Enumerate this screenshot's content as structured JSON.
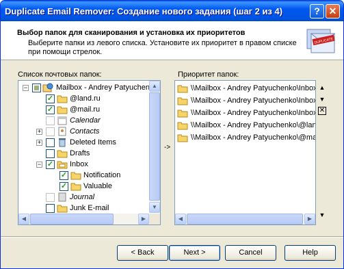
{
  "window": {
    "title": "Duplicate Email Remover: Создание нового задания (шаг 2 из 4)"
  },
  "titlebar": {
    "help": "?",
    "close": "✕"
  },
  "header": {
    "title": "Выбор папок для сканирования и установка их приоритетов",
    "subtitle": "Выберите папки из левого списка. Установите их приоритет в правом списке при помощи стрелок.",
    "icon_label": "DUPLICATE"
  },
  "left": {
    "label": "Список почтовых папок:",
    "items": [
      {
        "label": "Mailbox - Andrey Patyuchenko"
      },
      {
        "label": "@land.ru"
      },
      {
        "label": "@mail.ru"
      },
      {
        "label": "Calendar"
      },
      {
        "label": "Contacts"
      },
      {
        "label": "Deleted Items"
      },
      {
        "label": "Drafts"
      },
      {
        "label": "Inbox"
      },
      {
        "label": "Notification"
      },
      {
        "label": "Valuable"
      },
      {
        "label": "Journal"
      },
      {
        "label": "Junk E-mail"
      }
    ]
  },
  "right": {
    "label": "Приоритет папок:",
    "items": [
      {
        "label": "\\\\Mailbox - Andrey Patyuchenko\\Inbox"
      },
      {
        "label": "\\\\Mailbox - Andrey Patyuchenko\\Inbox"
      },
      {
        "label": "\\\\Mailbox - Andrey Patyuchenko\\Inbox"
      },
      {
        "label": "\\\\Mailbox - Andrey Patyuchenko\\@land.ru"
      },
      {
        "label": "\\\\Mailbox - Andrey Patyuchenko\\@mail.ru"
      }
    ]
  },
  "controls": {
    "arrow": "->",
    "up": "▲",
    "down": "▼",
    "delete": "✕",
    "more": "▼"
  },
  "buttons": {
    "back": "< Back",
    "next": "Next >",
    "cancel": "Cancel",
    "help": "Help"
  }
}
